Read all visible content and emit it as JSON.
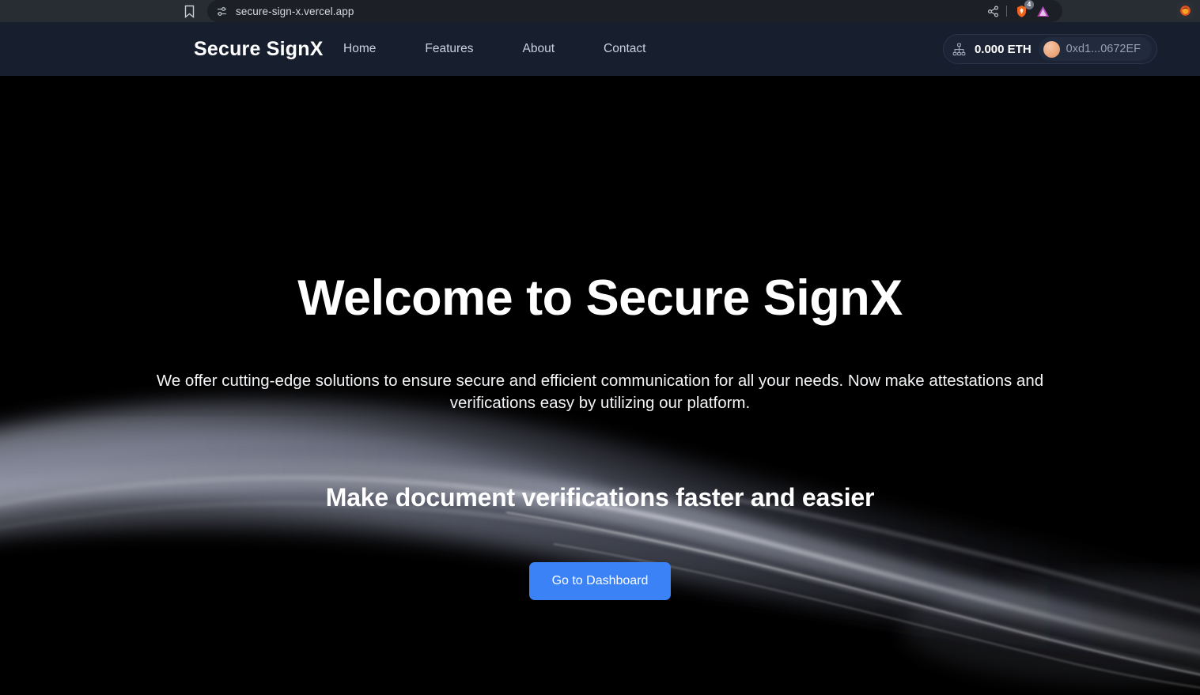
{
  "browser": {
    "bookmark_icon": "bookmark-icon",
    "sliders_icon": "sliders-icon",
    "url": "secure-sign-x.vercel.app",
    "share_icon": "share-icon",
    "brave_icon": "brave-shield-icon",
    "brave_badge": "4",
    "triangle_icon": "triangle-icon",
    "far_app_icon": "firefox-icon"
  },
  "navbar": {
    "brand": "Secure SignX",
    "links": [
      {
        "label": "Home"
      },
      {
        "label": "Features"
      },
      {
        "label": "About"
      },
      {
        "label": "Contact"
      }
    ],
    "wallet": {
      "network_icon": "network-nodes-icon",
      "balance": "0.000 ETH",
      "avatar_icon": "wallet-avatar",
      "address": "0xd1...0672EF"
    }
  },
  "hero": {
    "title": "Welcome to Secure SignX",
    "subtitle": "We offer cutting-edge solutions to ensure secure and efficient communication for all your needs. Now make attestations and verifications easy by utilizing our platform.",
    "tagline": "Make document verifications faster and easier",
    "cta_label": "Go to Dashboard"
  },
  "colors": {
    "navbar_bg": "#171e2e",
    "hero_bg": "#000000",
    "cta_blue": "#3b82f6",
    "nav_link": "#c9d2de",
    "address_text": "#95a0b2"
  }
}
